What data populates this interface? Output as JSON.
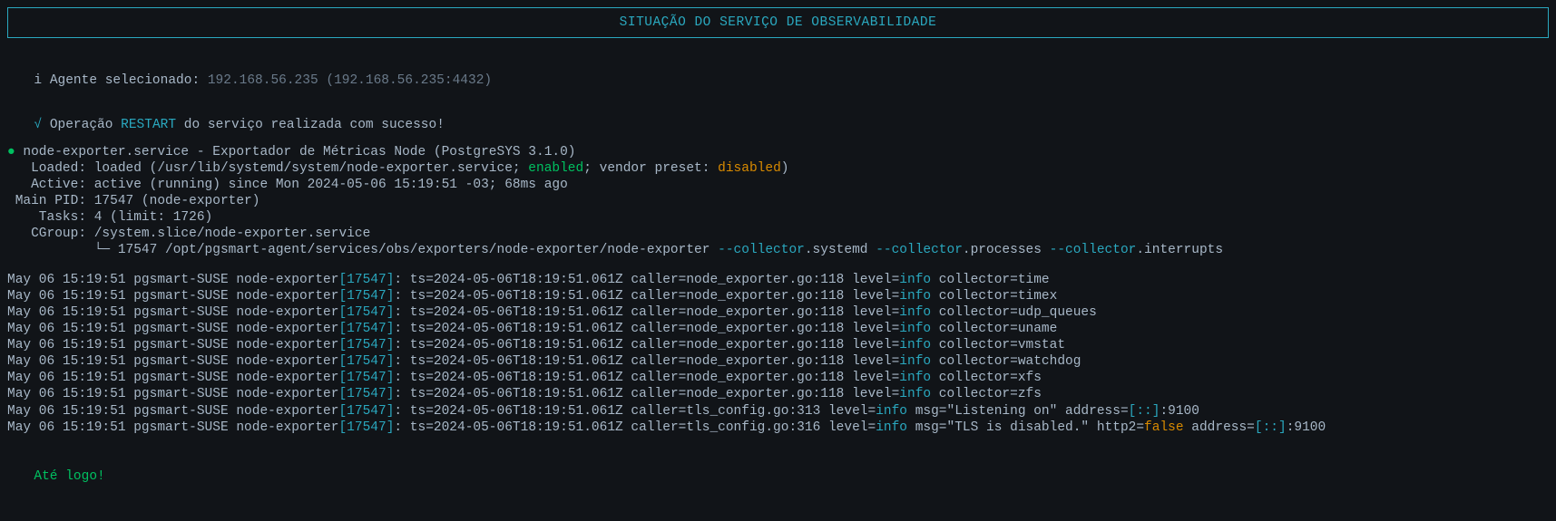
{
  "title": "SITUAÇÃO DO SERVIÇO DE OBSERVABILIDADE",
  "agent": {
    "icon": "i",
    "label": "Agente selecionado: ",
    "value": "192.168.56.235 (192.168.56.235:4432)"
  },
  "operation": {
    "check": "√",
    "prefix": "Operação ",
    "name": "RESTART",
    "suffix": " do serviço realizada com sucesso!"
  },
  "service": {
    "bullet": "●",
    "header": " node-exporter.service - Exportador de Métricas Node (PostgreSYS 3.1.0)",
    "loaded_label": "   Loaded: ",
    "loaded_pre": "loaded (/usr/lib/systemd/system/node-exporter.service; ",
    "loaded_enabled": "enabled",
    "loaded_mid": "; vendor preset: ",
    "loaded_disabled": "disabled",
    "loaded_end": ")",
    "active_label": "   Active: ",
    "active_value": "active (running) since Mon 2024-05-06 15:19:51 -03; 68ms ago",
    "mainpid_label": " Main PID: ",
    "mainpid_value": "17547 (node-exporter)",
    "tasks_label": "    Tasks: ",
    "tasks_value": "4 (limit: 1726)",
    "cgroup_label": "   CGroup: ",
    "cgroup_value": "/system.slice/node-exporter.service",
    "cgroup_tree_prefix": "           └─ 17547 /opt/pgsmart-agent/services/obs/exporters/node-exporter/node-exporter ",
    "arg1_flag": "--collector",
    "arg1_rest": ".systemd ",
    "arg2_flag": "--collector",
    "arg2_rest": ".processes ",
    "arg3_flag": "--collector",
    "arg3_rest": ".interrupts"
  },
  "logs": [
    {
      "pre": "May 06 15:19:51 pgsmart-SUSE node-exporter",
      "lb": "[",
      "pid": "17547",
      "rb": "]",
      "colon": ": ",
      "body": "ts=2024-05-06T18:19:51.061Z caller=node_exporter.go:118 level=",
      "level": "info",
      "tail": " collector=time"
    },
    {
      "pre": "May 06 15:19:51 pgsmart-SUSE node-exporter",
      "lb": "[",
      "pid": "17547",
      "rb": "]",
      "colon": ": ",
      "body": "ts=2024-05-06T18:19:51.061Z caller=node_exporter.go:118 level=",
      "level": "info",
      "tail": " collector=timex"
    },
    {
      "pre": "May 06 15:19:51 pgsmart-SUSE node-exporter",
      "lb": "[",
      "pid": "17547",
      "rb": "]",
      "colon": ": ",
      "body": "ts=2024-05-06T18:19:51.061Z caller=node_exporter.go:118 level=",
      "level": "info",
      "tail": " collector=udp_queues"
    },
    {
      "pre": "May 06 15:19:51 pgsmart-SUSE node-exporter",
      "lb": "[",
      "pid": "17547",
      "rb": "]",
      "colon": ": ",
      "body": "ts=2024-05-06T18:19:51.061Z caller=node_exporter.go:118 level=",
      "level": "info",
      "tail": " collector=uname"
    },
    {
      "pre": "May 06 15:19:51 pgsmart-SUSE node-exporter",
      "lb": "[",
      "pid": "17547",
      "rb": "]",
      "colon": ": ",
      "body": "ts=2024-05-06T18:19:51.061Z caller=node_exporter.go:118 level=",
      "level": "info",
      "tail": " collector=vmstat"
    },
    {
      "pre": "May 06 15:19:51 pgsmart-SUSE node-exporter",
      "lb": "[",
      "pid": "17547",
      "rb": "]",
      "colon": ": ",
      "body": "ts=2024-05-06T18:19:51.061Z caller=node_exporter.go:118 level=",
      "level": "info",
      "tail": " collector=watchdog"
    },
    {
      "pre": "May 06 15:19:51 pgsmart-SUSE node-exporter",
      "lb": "[",
      "pid": "17547",
      "rb": "]",
      "colon": ": ",
      "body": "ts=2024-05-06T18:19:51.061Z caller=node_exporter.go:118 level=",
      "level": "info",
      "tail": " collector=xfs"
    },
    {
      "pre": "May 06 15:19:51 pgsmart-SUSE node-exporter",
      "lb": "[",
      "pid": "17547",
      "rb": "]",
      "colon": ": ",
      "body": "ts=2024-05-06T18:19:51.061Z caller=node_exporter.go:118 level=",
      "level": "info",
      "tail": " collector=zfs"
    },
    {
      "pre": "May 06 15:19:51 pgsmart-SUSE node-exporter",
      "lb": "[",
      "pid": "17547",
      "rb": "]",
      "colon": ": ",
      "body": "ts=2024-05-06T18:19:51.061Z caller=tls_config.go:313 level=",
      "level": "info",
      "tail_parts": {
        "a": " msg=\"Listening on\" address=",
        "lb": "[",
        "addr": "::",
        "rb": "]",
        "port": ":9100"
      }
    },
    {
      "pre": "May 06 15:19:51 pgsmart-SUSE node-exporter",
      "lb": "[",
      "pid": "17547",
      "rb": "]",
      "colon": ": ",
      "body": "ts=2024-05-06T18:19:51.061Z caller=tls_config.go:316 level=",
      "level": "info",
      "tail_parts2": {
        "a": " msg=\"TLS is disabled.\" http2=",
        "false": "false",
        "b": " address=",
        "lb": "[",
        "addr": "::",
        "rb": "]",
        "port": ":9100"
      }
    }
  ],
  "goodbye": "Até logo!"
}
